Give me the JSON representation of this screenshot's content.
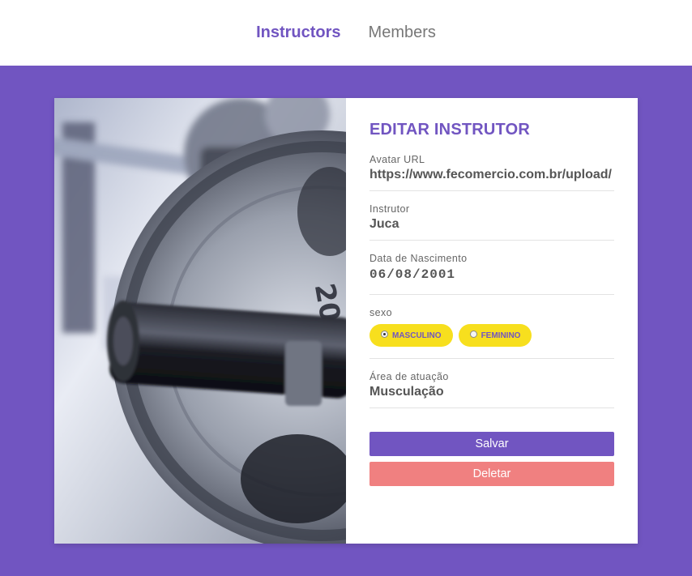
{
  "nav": {
    "instructors_label": "Instructors",
    "members_label": "Members"
  },
  "form": {
    "title": "EDITAR INSTRUTOR",
    "avatar": {
      "label": "Avatar URL",
      "value": "https://www.fecomercio.com.br/upload/"
    },
    "name": {
      "label": "Instrutor",
      "value": "Juca"
    },
    "birth": {
      "label": "Data de Nascimento",
      "value": "06/08/2001"
    },
    "gender": {
      "label": "sexo",
      "options": [
        {
          "label": "MASCULINO",
          "selected": true
        },
        {
          "label": "FEMININO",
          "selected": false
        }
      ]
    },
    "area": {
      "label": "Área de atuação",
      "value": "Musculação"
    },
    "save_label": "Salvar",
    "delete_label": "Deletar"
  },
  "photo": {
    "plate_text": "20KG"
  },
  "colors": {
    "accent": "#7155c1",
    "pill": "#f7df1e",
    "delete": "#f08080"
  }
}
